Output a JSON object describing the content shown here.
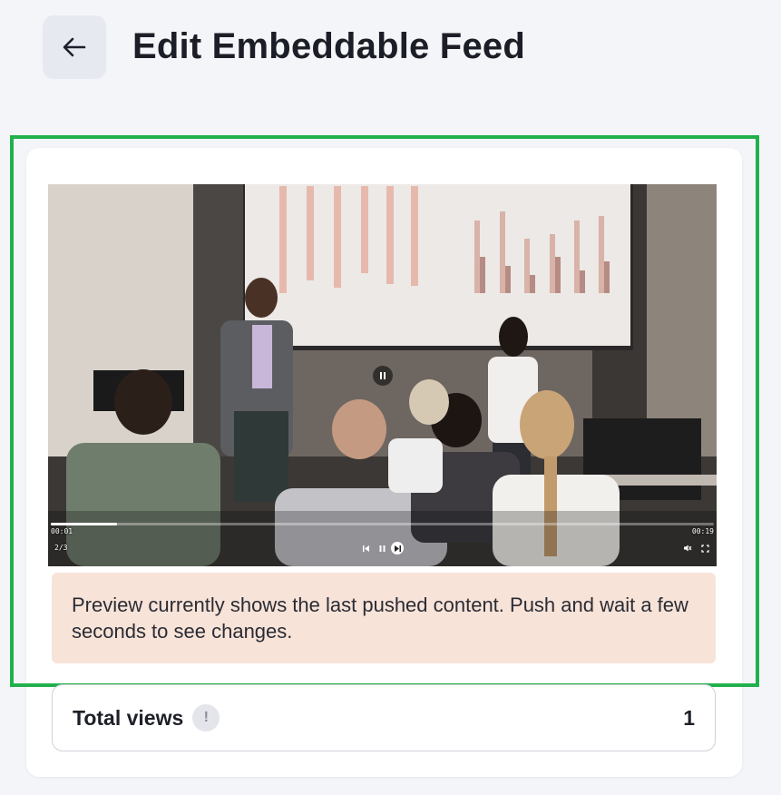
{
  "header": {
    "title": "Edit Embeddable Feed",
    "back_icon": "arrow-left-icon"
  },
  "video": {
    "current_time": "00:01",
    "duration": "00:19",
    "item_counter": "2/3",
    "progress": 0.1,
    "controls": [
      "previous-icon",
      "pause-icon",
      "next-icon",
      "mute-icon",
      "fullscreen-icon"
    ]
  },
  "notice": {
    "text": "Preview currently shows the last pushed content. Push and wait a few seconds to see changes."
  },
  "stats": {
    "total_views_label": "Total views",
    "info_symbol": "!",
    "total_views_value": "1"
  },
  "colors": {
    "highlight": "#21b04b",
    "notice_bg": "#f8e3d8",
    "page_bg": "#f4f5f9"
  }
}
